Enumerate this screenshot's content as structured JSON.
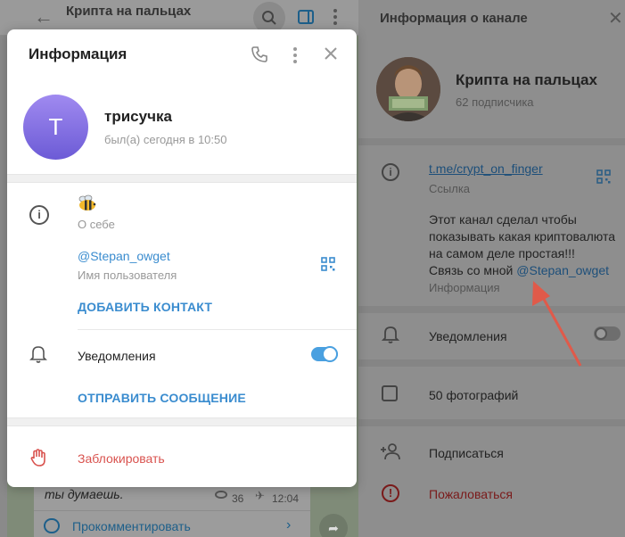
{
  "chat": {
    "title": "Крипта на пальцах",
    "message_text": "ты думаешь.",
    "views": "36",
    "time": "12:04",
    "comment_label": "Прокомментировать"
  },
  "channel_panel": {
    "title": "Информация о канале",
    "name": "Крипта на пальцах",
    "subscribers": "62 подписчика",
    "link": "t.me/crypt_on_finger",
    "link_sub": "Ссылка",
    "description_line1": "Этот канал сделал чтобы",
    "description_line2": "показывать какая криптовалюта",
    "description_line3": "на самом деле простая!!!",
    "description_line4_prefix": "Связь со мной",
    "description_link": "@Stepan_owget",
    "description_sub": "Информация",
    "notifications": "Уведомления",
    "notifications_enabled": false,
    "photos": "50 фотографий",
    "subscribe": "Подписаться",
    "report": "Пожаловаться"
  },
  "modal": {
    "title": "Информация",
    "avatar_letter": "Т",
    "name": "трисучка",
    "status": "был(а) сегодня в 10:50",
    "about_sub": "О себе",
    "username": "@Stepan_owget",
    "username_sub": "Имя пользователя",
    "add_contact": "ДОБАВИТЬ КОНТАКТ",
    "notifications": "Уведомления",
    "notifications_enabled": true,
    "send_message": "ОТПРАВИТЬ СООБЩЕНИЕ",
    "block": "Заблокировать"
  },
  "colors": {
    "accent": "#3a8ccf",
    "danger": "#d9534f",
    "avatar_gradient_top": "#a08af0",
    "avatar_gradient_bottom": "#6c5bd6",
    "annotation_arrow": "#e05a4a"
  }
}
